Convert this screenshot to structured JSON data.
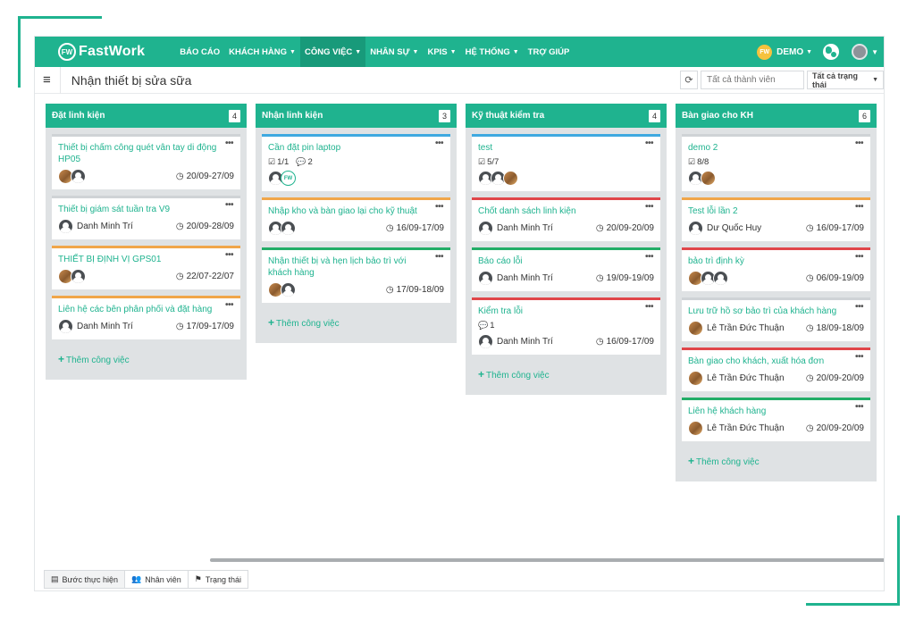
{
  "app": {
    "logo_badge": "FW",
    "logo_text": "FastWork",
    "menu": [
      {
        "label": "BÁO CÁO",
        "caret": ""
      },
      {
        "label": "KHÁCH HÀNG",
        "caret": "▼"
      },
      {
        "label": "CÔNG VIỆC",
        "caret": "▼"
      },
      {
        "label": "NHÂN SỰ",
        "caret": "▼"
      },
      {
        "label": "KPIS",
        "caret": "▼"
      },
      {
        "label": "HỆ THỐNG",
        "caret": "▼"
      },
      {
        "label": "TRỢ GIÚP",
        "caret": ""
      }
    ],
    "user_badge": "FW",
    "user_name": "DEMO",
    "caret": "▼"
  },
  "subheader": {
    "hamburger": "≡",
    "title": "Nhận thiết bị sửa sữa",
    "refresh": "⟳",
    "member_placeholder": "Tất cả thành viên",
    "status_filter": "Tất cả trạng thái"
  },
  "columns": [
    {
      "title": "Đặt linh kiện",
      "count": "4",
      "add_label": "Thêm công việc",
      "cards": [
        {
          "title": "Thiết bị chấm công quét vân tay di động HP05",
          "assignee": "",
          "due": "20/09-27/09"
        },
        {
          "title": "Thiết bị giám sát tuần tra V9",
          "assignee": "Danh Minh Trí",
          "due": "20/09-28/09"
        },
        {
          "title": "THIẾT BỊ ĐỊNH VỊ GPS01",
          "assignee": "",
          "due": "22/07-22/07"
        },
        {
          "title": "Liên hệ các bên phân phối và đặt hàng",
          "assignee": "Danh Minh Trí",
          "due": "17/09-17/09"
        }
      ]
    },
    {
      "title": "Nhận linh kiện",
      "count": "3",
      "add_label": "Thêm công việc",
      "cards": [
        {
          "title": "Cần đặt pin laptop",
          "check": "1/1",
          "comments": "2",
          "fw_badge": "FW"
        },
        {
          "title": "Nhập kho và bàn giao lại cho kỹ thuật",
          "due": "16/09-17/09"
        },
        {
          "title": "Nhận thiết bị và hẹn lịch bảo trì với khách hàng",
          "due": "17/09-18/09"
        }
      ]
    },
    {
      "title": "Kỹ thuật kiểm tra",
      "count": "4",
      "add_label": "Thêm công việc",
      "cards": [
        {
          "title": "test",
          "check": "5/7"
        },
        {
          "title": "Chốt danh sách linh kiện",
          "assignee": "Danh Minh Trí",
          "due": "20/09-20/09"
        },
        {
          "title": "Báo cáo lỗi",
          "assignee": "Danh Minh Trí",
          "due": "19/09-19/09"
        },
        {
          "title": "Kiểm tra lỗi",
          "comments": "1",
          "assignee": "Danh Minh Trí",
          "due": "16/09-17/09"
        }
      ]
    },
    {
      "title": "Bàn giao cho KH",
      "count": "6",
      "add_label": "Thêm công việc",
      "cards": [
        {
          "title": "demo 2",
          "check": "8/8"
        },
        {
          "title": "Test lỗi lần 2",
          "assignee": "Dư Quốc Huy",
          "due": "16/09-17/09"
        },
        {
          "title": "bảo trì định kỳ",
          "due": "06/09-19/09"
        },
        {
          "title": "Lưu trữ hồ sơ bảo trì của khách hàng",
          "assignee": "Lê Trần Đức Thuận",
          "due": "18/09-18/09"
        },
        {
          "title": "Bàn giao cho khách, xuất hóa đơn",
          "assignee": "Lê Trần Đức Thuận",
          "due": "20/09-20/09"
        },
        {
          "title": "Liên hệ khách hàng",
          "assignee": "Lê Trần Đức Thuận",
          "due": "20/09-20/09"
        }
      ]
    }
  ],
  "bottom_tabs": [
    {
      "label": "Bước thực hiện"
    },
    {
      "label": "Nhân viên"
    },
    {
      "label": "Trạng thái"
    }
  ],
  "colors": {
    "brand": "#1fb38f",
    "card_blue": "#3fa9e0",
    "card_orange": "#f0a64a",
    "card_red": "#e0464a",
    "card_green": "#22ad67"
  }
}
